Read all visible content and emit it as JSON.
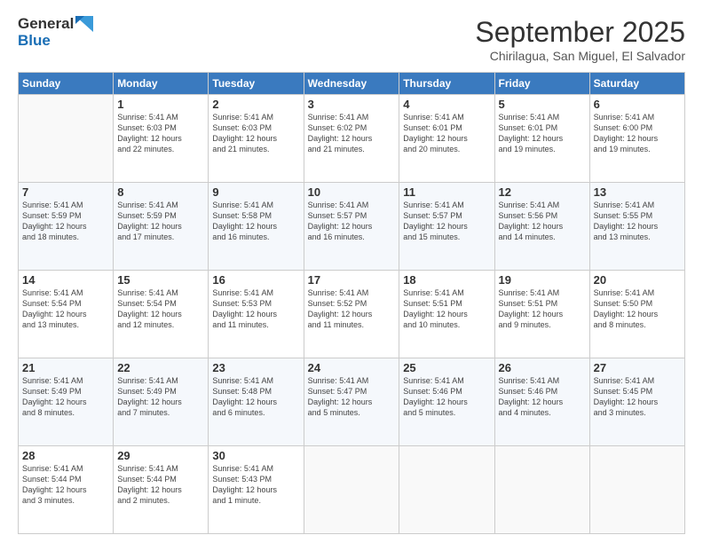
{
  "header": {
    "logo_line1": "General",
    "logo_line2": "Blue",
    "month": "September 2025",
    "location": "Chirilagua, San Miguel, El Salvador"
  },
  "days_of_week": [
    "Sunday",
    "Monday",
    "Tuesday",
    "Wednesday",
    "Thursday",
    "Friday",
    "Saturday"
  ],
  "weeks": [
    [
      {
        "day": "",
        "info": ""
      },
      {
        "day": "1",
        "info": "Sunrise: 5:41 AM\nSunset: 6:03 PM\nDaylight: 12 hours\nand 22 minutes."
      },
      {
        "day": "2",
        "info": "Sunrise: 5:41 AM\nSunset: 6:03 PM\nDaylight: 12 hours\nand 21 minutes."
      },
      {
        "day": "3",
        "info": "Sunrise: 5:41 AM\nSunset: 6:02 PM\nDaylight: 12 hours\nand 21 minutes."
      },
      {
        "day": "4",
        "info": "Sunrise: 5:41 AM\nSunset: 6:01 PM\nDaylight: 12 hours\nand 20 minutes."
      },
      {
        "day": "5",
        "info": "Sunrise: 5:41 AM\nSunset: 6:01 PM\nDaylight: 12 hours\nand 19 minutes."
      },
      {
        "day": "6",
        "info": "Sunrise: 5:41 AM\nSunset: 6:00 PM\nDaylight: 12 hours\nand 19 minutes."
      }
    ],
    [
      {
        "day": "7",
        "info": "Sunrise: 5:41 AM\nSunset: 5:59 PM\nDaylight: 12 hours\nand 18 minutes."
      },
      {
        "day": "8",
        "info": "Sunrise: 5:41 AM\nSunset: 5:59 PM\nDaylight: 12 hours\nand 17 minutes."
      },
      {
        "day": "9",
        "info": "Sunrise: 5:41 AM\nSunset: 5:58 PM\nDaylight: 12 hours\nand 16 minutes."
      },
      {
        "day": "10",
        "info": "Sunrise: 5:41 AM\nSunset: 5:57 PM\nDaylight: 12 hours\nand 16 minutes."
      },
      {
        "day": "11",
        "info": "Sunrise: 5:41 AM\nSunset: 5:57 PM\nDaylight: 12 hours\nand 15 minutes."
      },
      {
        "day": "12",
        "info": "Sunrise: 5:41 AM\nSunset: 5:56 PM\nDaylight: 12 hours\nand 14 minutes."
      },
      {
        "day": "13",
        "info": "Sunrise: 5:41 AM\nSunset: 5:55 PM\nDaylight: 12 hours\nand 13 minutes."
      }
    ],
    [
      {
        "day": "14",
        "info": "Sunrise: 5:41 AM\nSunset: 5:54 PM\nDaylight: 12 hours\nand 13 minutes."
      },
      {
        "day": "15",
        "info": "Sunrise: 5:41 AM\nSunset: 5:54 PM\nDaylight: 12 hours\nand 12 minutes."
      },
      {
        "day": "16",
        "info": "Sunrise: 5:41 AM\nSunset: 5:53 PM\nDaylight: 12 hours\nand 11 minutes."
      },
      {
        "day": "17",
        "info": "Sunrise: 5:41 AM\nSunset: 5:52 PM\nDaylight: 12 hours\nand 11 minutes."
      },
      {
        "day": "18",
        "info": "Sunrise: 5:41 AM\nSunset: 5:51 PM\nDaylight: 12 hours\nand 10 minutes."
      },
      {
        "day": "19",
        "info": "Sunrise: 5:41 AM\nSunset: 5:51 PM\nDaylight: 12 hours\nand 9 minutes."
      },
      {
        "day": "20",
        "info": "Sunrise: 5:41 AM\nSunset: 5:50 PM\nDaylight: 12 hours\nand 8 minutes."
      }
    ],
    [
      {
        "day": "21",
        "info": "Sunrise: 5:41 AM\nSunset: 5:49 PM\nDaylight: 12 hours\nand 8 minutes."
      },
      {
        "day": "22",
        "info": "Sunrise: 5:41 AM\nSunset: 5:49 PM\nDaylight: 12 hours\nand 7 minutes."
      },
      {
        "day": "23",
        "info": "Sunrise: 5:41 AM\nSunset: 5:48 PM\nDaylight: 12 hours\nand 6 minutes."
      },
      {
        "day": "24",
        "info": "Sunrise: 5:41 AM\nSunset: 5:47 PM\nDaylight: 12 hours\nand 5 minutes."
      },
      {
        "day": "25",
        "info": "Sunrise: 5:41 AM\nSunset: 5:46 PM\nDaylight: 12 hours\nand 5 minutes."
      },
      {
        "day": "26",
        "info": "Sunrise: 5:41 AM\nSunset: 5:46 PM\nDaylight: 12 hours\nand 4 minutes."
      },
      {
        "day": "27",
        "info": "Sunrise: 5:41 AM\nSunset: 5:45 PM\nDaylight: 12 hours\nand 3 minutes."
      }
    ],
    [
      {
        "day": "28",
        "info": "Sunrise: 5:41 AM\nSunset: 5:44 PM\nDaylight: 12 hours\nand 3 minutes."
      },
      {
        "day": "29",
        "info": "Sunrise: 5:41 AM\nSunset: 5:44 PM\nDaylight: 12 hours\nand 2 minutes."
      },
      {
        "day": "30",
        "info": "Sunrise: 5:41 AM\nSunset: 5:43 PM\nDaylight: 12 hours\nand 1 minute."
      },
      {
        "day": "",
        "info": ""
      },
      {
        "day": "",
        "info": ""
      },
      {
        "day": "",
        "info": ""
      },
      {
        "day": "",
        "info": ""
      }
    ]
  ]
}
